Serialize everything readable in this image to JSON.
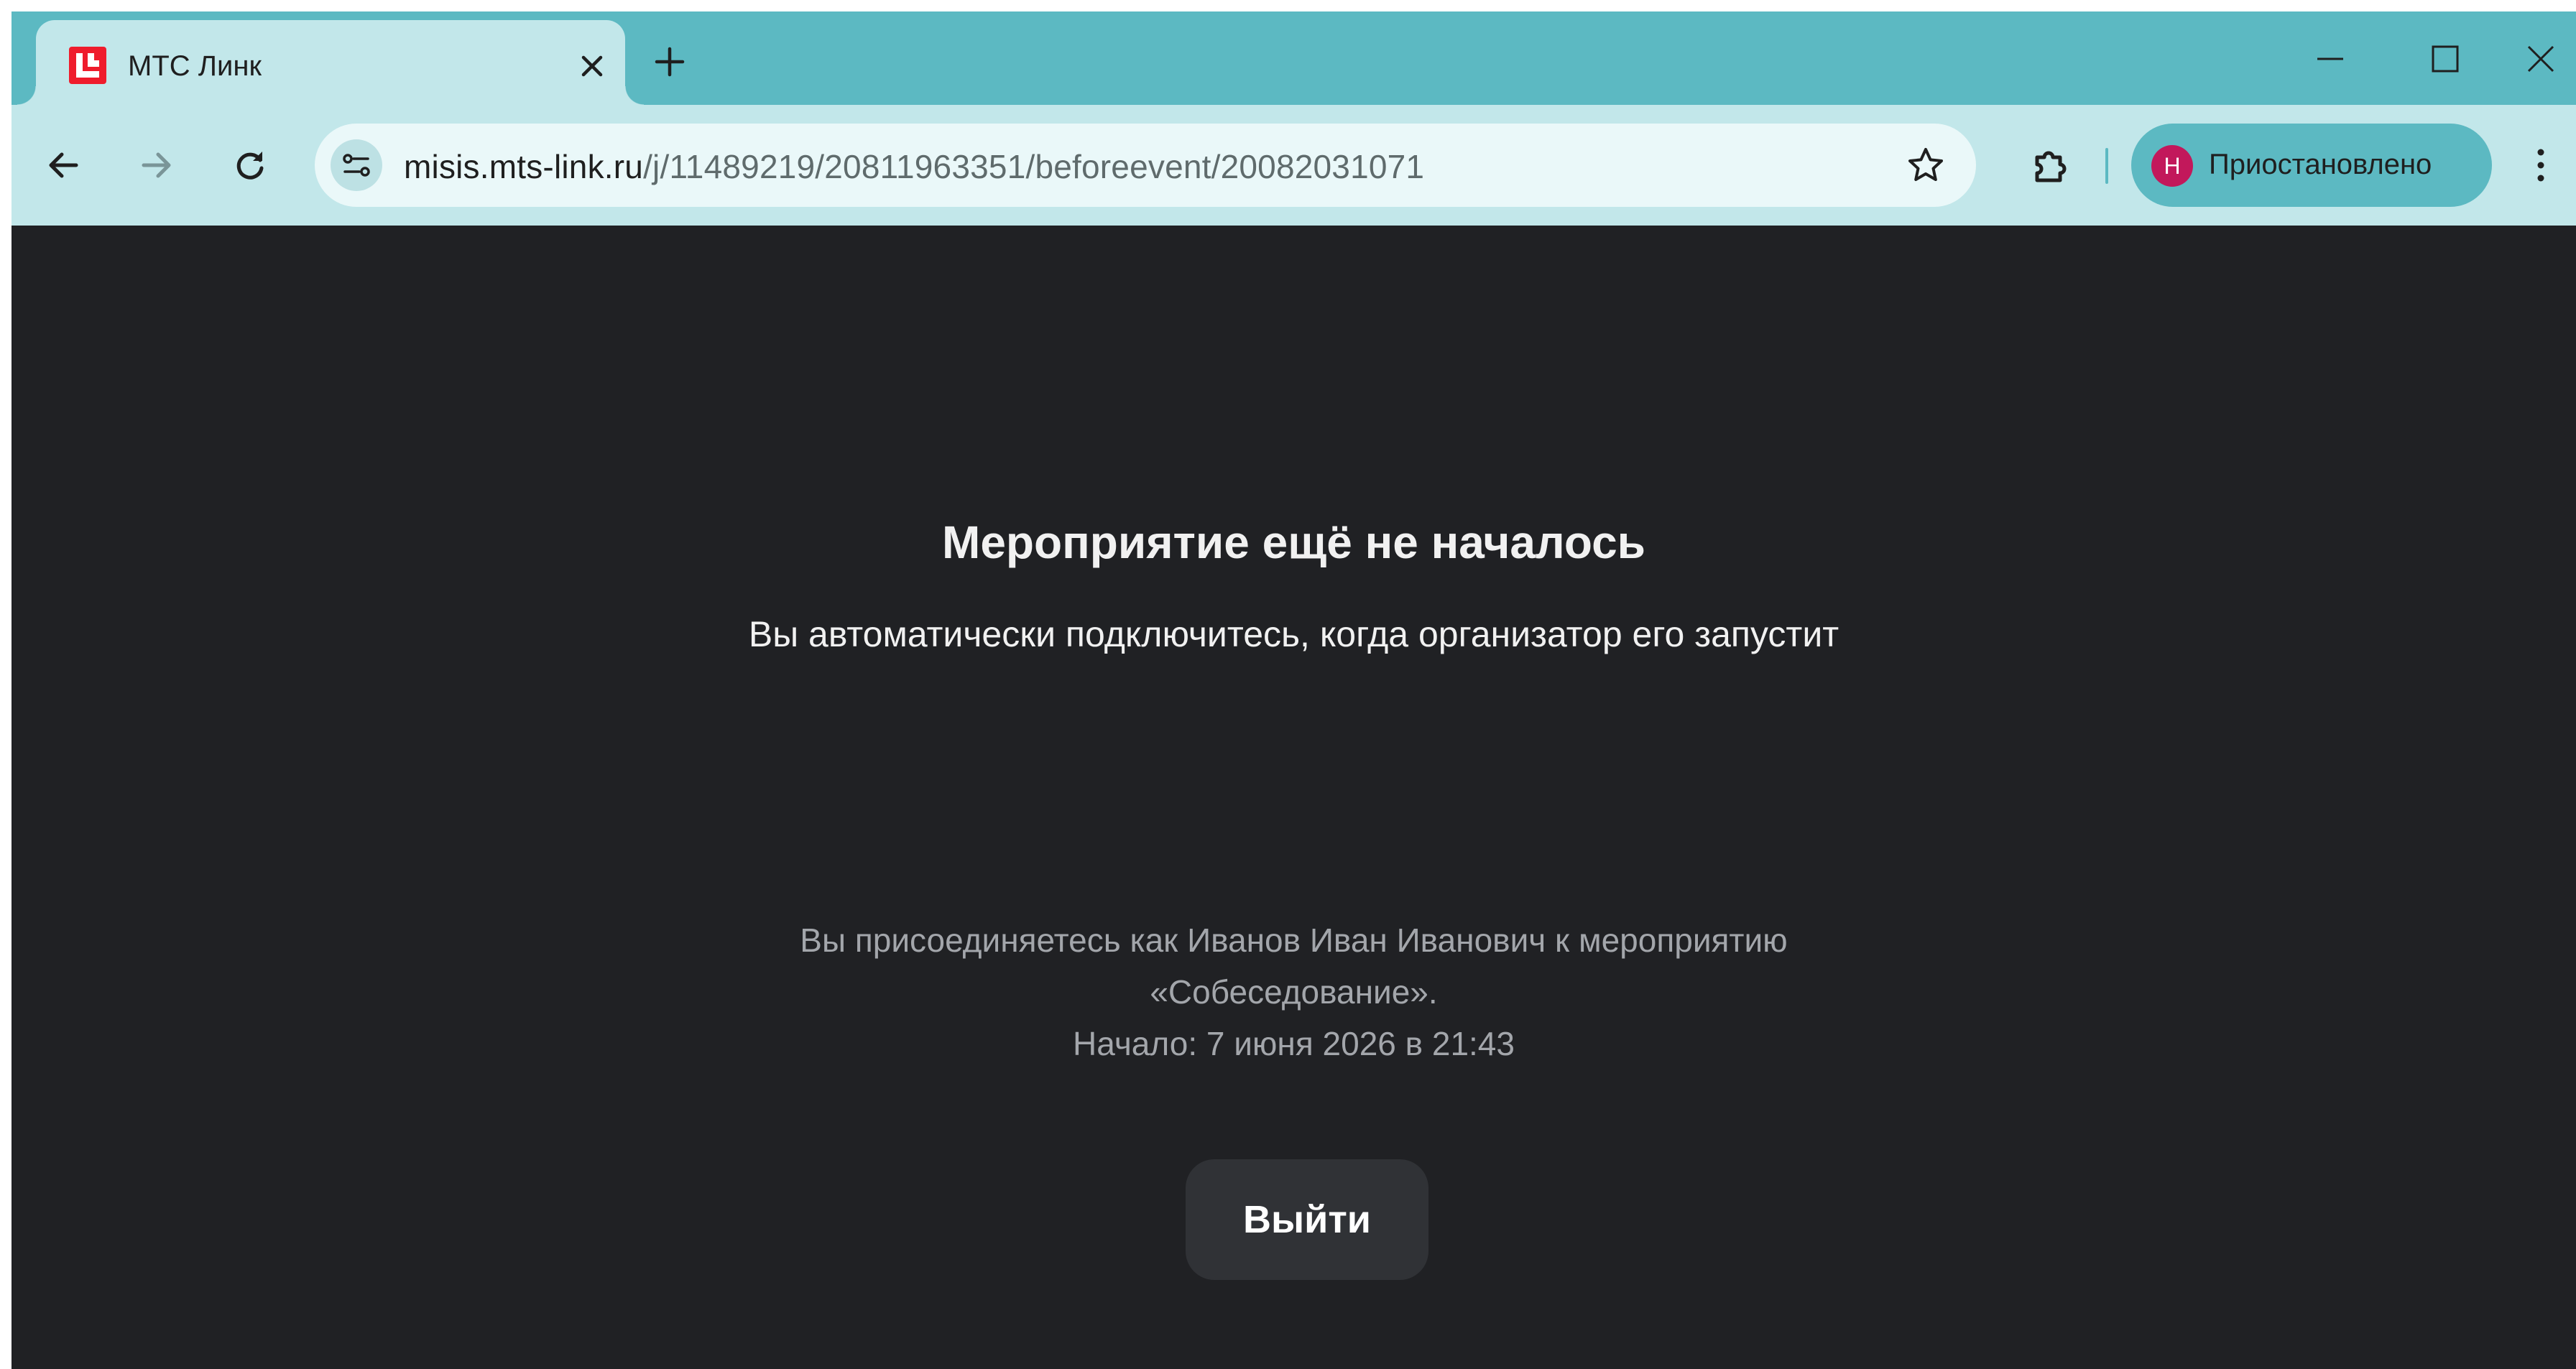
{
  "browser": {
    "tab": {
      "title": "МТС Линк"
    },
    "address_bar": {
      "url_host": "misis.mts-link.ru",
      "url_path": "/j/11489219/20811963351/beforeevent/20082031071"
    },
    "profile": {
      "initial": "Н",
      "label": "Приостановлено"
    }
  },
  "page": {
    "heading": "Мероприятие ещё не началось",
    "subheading": "Вы автоматически подключитесь, когда организатор его запустит",
    "info_line1": "Вы присоединяетесь как Иванов Иван Иванович к мероприятию",
    "info_line2": "«Собеседование».",
    "info_line3": "Начало: 7 июня 2026 в 21:43",
    "exit_label": "Выйти"
  },
  "colors": {
    "tab_strip": "#5cb9c2",
    "toolbar": "#c2e7ea",
    "page_background": "#202124",
    "favicon": "#ef1c2c",
    "avatar": "#c2185b",
    "exit_button": "#303236"
  }
}
